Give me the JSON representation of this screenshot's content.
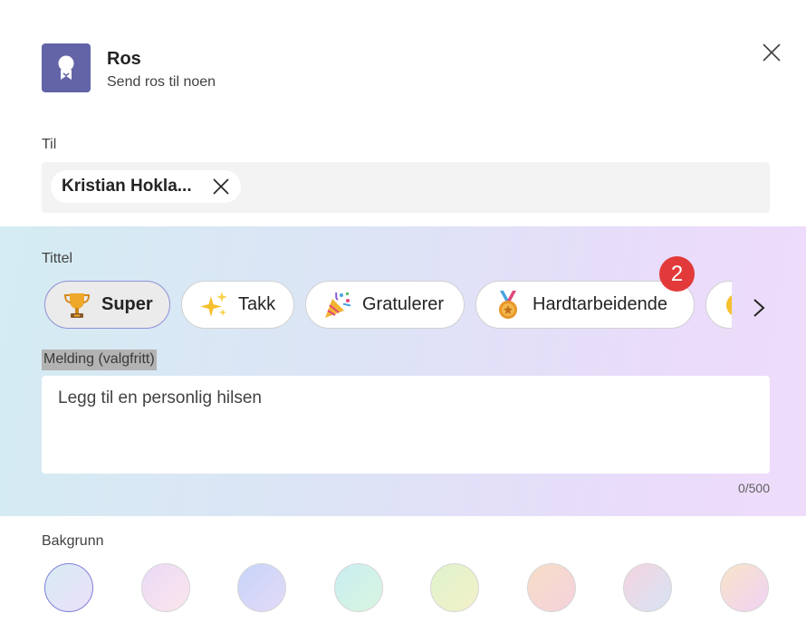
{
  "header": {
    "title": "Ros",
    "subtitle": "Send ros til noen",
    "app_icon": "award-ribbon-icon",
    "close_icon": "close-icon"
  },
  "to": {
    "label": "Til",
    "recipient": "Kristian Hokla..."
  },
  "title_section": {
    "label": "Tittel",
    "options": [
      {
        "label": "Super",
        "icon": "trophy-icon",
        "selected": true
      },
      {
        "label": "Takk",
        "icon": "sparkles-icon",
        "selected": false
      },
      {
        "label": "Gratulerer",
        "icon": "party-popper-icon",
        "selected": false
      },
      {
        "label": "Hardtarbeidende",
        "icon": "medal-icon",
        "selected": false
      }
    ],
    "badge": "2"
  },
  "message": {
    "label": "Melding (valgfritt)",
    "placeholder": "Legg til en personlig hilsen",
    "char_count": "0/500"
  },
  "background": {
    "label": "Bakgrunn",
    "selected_index": 0,
    "swatches": [
      "linear-gradient(135deg,#d6ecf3,#ece0fb)",
      "linear-gradient(135deg,#ead9f7,#fbe6ec)",
      "linear-gradient(135deg,#c6d4f8,#e3daf8)",
      "linear-gradient(135deg,#c9eef2,#d9f5df)",
      "linear-gradient(135deg,#dff2cc,#f3f1c8)",
      "linear-gradient(135deg,#f6ddc7,#f5d2dc)",
      "linear-gradient(135deg,#f5d3df,#d6e4f5)",
      "linear-gradient(135deg,#f8e4c8,#f0d2f4)"
    ]
  },
  "colors": {
    "accent": "#6264a7",
    "badge": "#e23a3a"
  }
}
